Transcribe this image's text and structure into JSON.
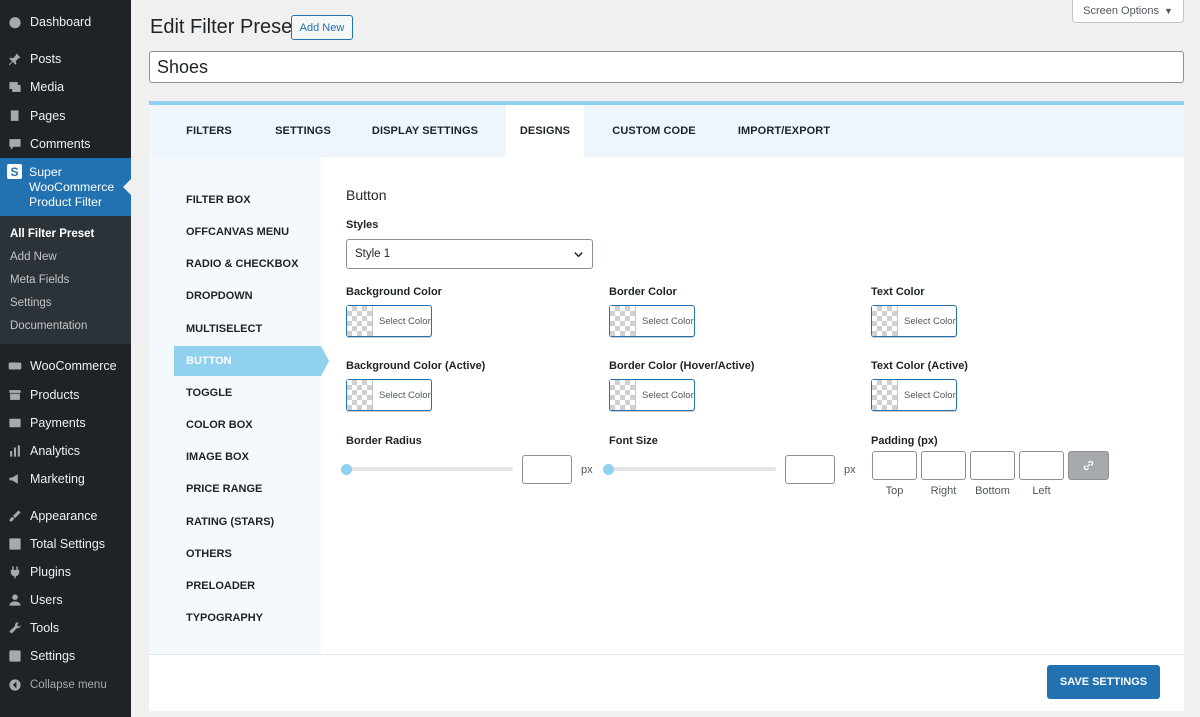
{
  "sidebar": {
    "items": [
      {
        "label": "Dashboard",
        "icon": "dashboard-icon"
      },
      {
        "label": "Posts",
        "icon": "pushpin-icon"
      },
      {
        "label": "Media",
        "icon": "media-icon"
      },
      {
        "label": "Pages",
        "icon": "pages-icon"
      },
      {
        "label": "Comments",
        "icon": "comment-icon"
      },
      {
        "label": "WooCommerce",
        "icon": "woocommerce-icon"
      },
      {
        "label": "Products",
        "icon": "archive-icon"
      },
      {
        "label": "Payments",
        "icon": "payments-icon"
      },
      {
        "label": "Analytics",
        "icon": "bar-chart-icon"
      },
      {
        "label": "Marketing",
        "icon": "megaphone-icon"
      },
      {
        "label": "Appearance",
        "icon": "paintbrush-icon"
      },
      {
        "label": "Total Settings",
        "icon": "settings-panel-icon"
      },
      {
        "label": "Plugins",
        "icon": "plug-icon"
      },
      {
        "label": "Users",
        "icon": "user-icon"
      },
      {
        "label": "Tools",
        "icon": "wrench-icon"
      },
      {
        "label": "Settings",
        "icon": "settings-icon"
      },
      {
        "label": "Collapse menu",
        "icon": "collapse-icon"
      }
    ],
    "active": {
      "label": "Super WooCommerce Product Filter",
      "icon_glyph": "S"
    },
    "submenu": [
      "All Filter Preset",
      "Add New",
      "Meta Fields",
      "Settings",
      "Documentation"
    ]
  },
  "header": {
    "title": "Edit Filter Preset",
    "add_new": "Add New",
    "screen_options": "Screen Options",
    "preset_name": "Shoes"
  },
  "tabs": [
    "FILTERS",
    "SETTINGS",
    "DISPLAY SETTINGS",
    "DESIGNS",
    "CUSTOM CODE",
    "IMPORT/EXPORT"
  ],
  "active_tab": "DESIGNS",
  "design_nav": [
    "FILTER BOX",
    "OFFCANVAS MENU",
    "RADIO & CHECKBOX",
    "DROPDOWN",
    "MULTISELECT",
    "BUTTON",
    "TOGGLE",
    "COLOR BOX",
    "IMAGE BOX",
    "PRICE RANGE",
    "RATING (STARS)",
    "OTHERS",
    "PRELOADER",
    "TYPOGRAPHY"
  ],
  "active_design": "BUTTON",
  "section": {
    "title": "Button",
    "styles_label": "Styles",
    "style_value": "Style 1",
    "select_color": "Select Color",
    "colors": [
      "Background Color",
      "Border Color",
      "Text Color",
      "Background Color (Active)",
      "Border Color (Hover/Active)",
      "Text Color (Active)"
    ],
    "border_radius_label": "Border Radius",
    "font_size_label": "Font Size",
    "padding_label": "Padding (px)",
    "unit": "px",
    "padding_sides": [
      "Top",
      "Right",
      "Bottom",
      "Left"
    ]
  },
  "footer": {
    "save": "SAVE SETTINGS"
  },
  "theme": {
    "accent": "#2271b1",
    "highlight": "#8fd1ef",
    "sidebar_bg": "#1d2327"
  }
}
